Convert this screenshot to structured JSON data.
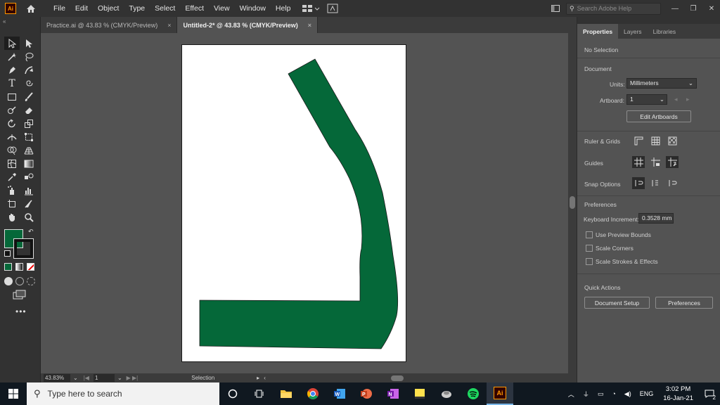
{
  "app": {
    "logo_text": "Ai"
  },
  "menu": [
    "File",
    "Edit",
    "Object",
    "Type",
    "Select",
    "Effect",
    "View",
    "Window",
    "Help"
  ],
  "search": {
    "placeholder": "Search Adobe Help"
  },
  "tabs": [
    {
      "label": "Practice.ai @ 43.83 % (CMYK/Preview)",
      "close": "×"
    },
    {
      "label": "Untitled-2* @ 43.83 % (CMYK/Preview)",
      "close": "×"
    }
  ],
  "status": {
    "zoom": "43.83%",
    "page": "1",
    "tool": "Selection"
  },
  "panel": {
    "tabs": [
      "Properties",
      "Layers",
      "Libraries"
    ],
    "no_selection": "No Selection",
    "document_title": "Document",
    "units_label": "Units:",
    "units_value": "Millimeters",
    "artboard_label": "Artboard:",
    "artboard_value": "1",
    "edit_artboards": "Edit Artboards",
    "ruler_grids": "Ruler & Grids",
    "guides": "Guides",
    "snap_options": "Snap Options",
    "preferences_title": "Preferences",
    "keyboard_increment_label": "Keyboard Increment:",
    "keyboard_increment_value": "0.3528 mm",
    "checkboxes": [
      "Use Preview Bounds",
      "Scale Corners",
      "Scale Strokes & Effects"
    ],
    "quick_actions": "Quick Actions",
    "document_setup": "Document Setup",
    "preferences_button": "Preferences"
  },
  "colors": {
    "fill": "#056839",
    "accent": "#ff9a00"
  },
  "taskbar": {
    "search_placeholder": "Type here to search",
    "lang": "ENG",
    "time": "3:02 PM",
    "date": "16-Jan-21",
    "notifications": "2"
  }
}
